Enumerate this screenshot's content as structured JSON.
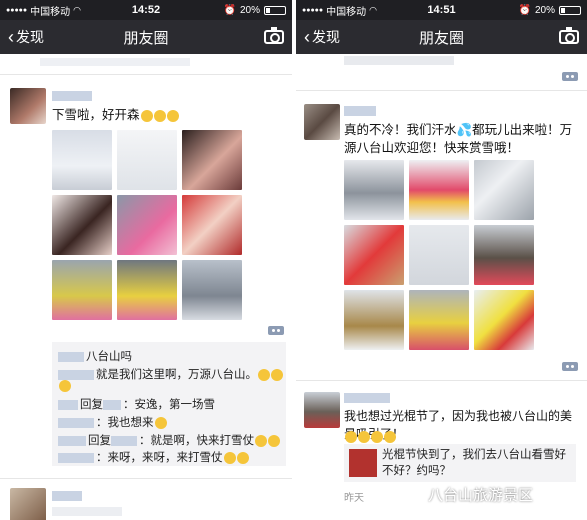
{
  "left": {
    "status": {
      "carrier": "中国移动",
      "time": "14:52",
      "battery": "20%"
    },
    "nav": {
      "back_label": "发现",
      "title": "朋友圈"
    },
    "post": {
      "text": "下雪啦，好开森",
      "comments": [
        {
          "text": "八台山吗"
        },
        {
          "text": "就是我们这里啊，万源八台山。"
        },
        {
          "reply": "回复",
          "text": "：安逸，第一场雪"
        },
        {
          "text": "我也想来"
        },
        {
          "reply": "回复",
          "text": "：就是啊，快来打雪仗"
        },
        {
          "text": "来呀，来呀，来打雪仗"
        }
      ]
    }
  },
  "right": {
    "status": {
      "carrier": "中国移动",
      "time": "14:51",
      "battery": "20%"
    },
    "nav": {
      "back_label": "发现",
      "title": "朋友圈"
    },
    "post1": {
      "text": "真的不冷！我们汗水💦都玩儿出来啦！万源八台山欢迎您！快来赏雪哦！"
    },
    "post2": {
      "text": "我也想过光棍节了，因为我也被八台山的美景吸引了！",
      "share_text": "光棍节快到了，我们去八台山看雪好不好？约吗？",
      "time": "昨天"
    },
    "watermark": "八台山旅游景区"
  },
  "colors": {
    "nav_bg": "#2b2b30",
    "status_bg": "#1f1f23",
    "comment_bg": "#f3f3f5",
    "name_blue": "#576b95"
  },
  "icons": [
    "back-chevron-icon",
    "camera-icon",
    "signal-dots-icon",
    "wifi-icon",
    "alarm-icon",
    "battery-icon",
    "more-options-icon",
    "wechat-logo-icon"
  ]
}
